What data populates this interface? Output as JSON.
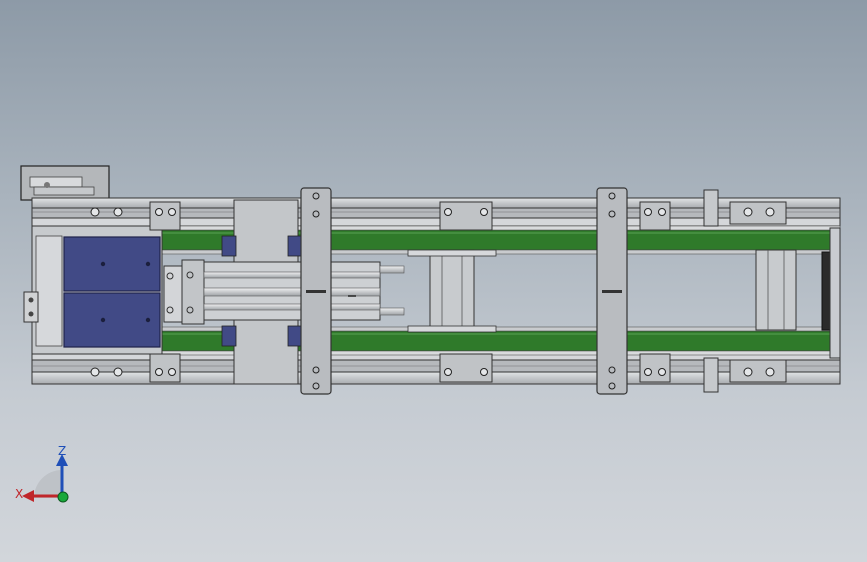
{
  "view": {
    "background_top": "#8d9aa7",
    "background_bottom": "#d2d6db"
  },
  "model": {
    "frame_color": "#c9ccd0",
    "belt_color": "#2f7a2a",
    "motor_color": "#414a86",
    "plate_color": "#b9bcc0",
    "outline_color": "#3b3b3b"
  },
  "triad": {
    "z_label": "Z",
    "x_label": "X",
    "z_color": "#1f4fb8",
    "x_color": "#c0262a",
    "y_color": "#18a83a"
  }
}
